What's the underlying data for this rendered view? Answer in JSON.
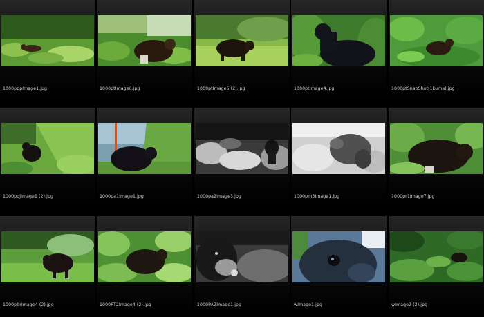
{
  "files": [
    {
      "name": "1000pppImage1.jpg",
      "thumb": "forest-bear-small-icon"
    },
    {
      "name": "1000ptImage6.jpg",
      "thumb": "forest-bear-icon"
    },
    {
      "name": "1000ptImage5 (2).jpg",
      "thumb": "meadow-bear-icon"
    },
    {
      "name": "1000ptImage4.jpg",
      "thumb": "standing-bear-icon"
    },
    {
      "name": "1000ptSnapShot(1kuma).jpg",
      "thumb": "bush-bear-icon"
    },
    {
      "name": "1000pqjImage1 (2).jpg",
      "thumb": "hillside-bear-icon"
    },
    {
      "name": "1000pa1Image1.jpg",
      "thumb": "bear-near-pole-icon"
    },
    {
      "name": "1000pa2Image3.jpg",
      "thumb": "night-bear-icon"
    },
    {
      "name": "1000pm3Image1.jpg",
      "thumb": "night-bear-closeup-icon"
    },
    {
      "name": "1000pr1Image7.jpg",
      "thumb": "large-bear-icon"
    },
    {
      "name": "1000pbrImage4 (2).jpg",
      "thumb": "grass-bear-icon"
    },
    {
      "name": "1000PT2Image4 (2).jpg",
      "thumb": "leafy-bear-icon"
    },
    {
      "name": "1000PAZImage1.jpg",
      "thumb": "night-bear-face-icon"
    },
    {
      "name": "wImage1.jpg",
      "thumb": "bear-face-closeup-icon"
    },
    {
      "name": "wImage2 (2).jpg",
      "thumb": "dense-brush-bear-icon"
    }
  ]
}
